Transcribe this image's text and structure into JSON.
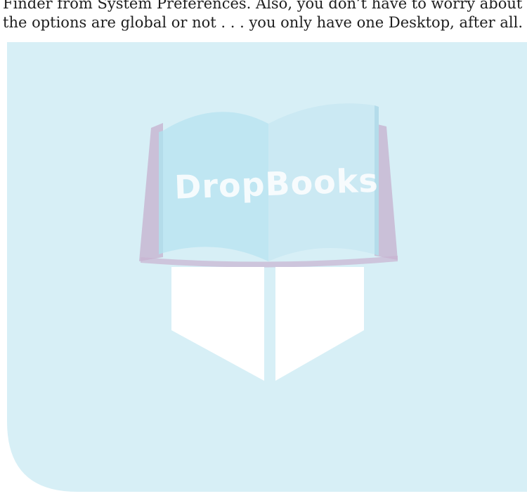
{
  "body_text": {
    "line1": "Finder from System Preferences. Also, you don’t have to worry about whether",
    "line2": "the options are global or not . . . you only have one Desktop, after all."
  },
  "watermark": {
    "logo_text": "DropBooks",
    "colors": {
      "background": "#d7eff6",
      "page_left": "#bfe6f2",
      "page_right": "#cbe9f3",
      "cover": "#bfa9c9",
      "bookmark": "#ffffff",
      "logo_text": "#ffffff"
    }
  }
}
